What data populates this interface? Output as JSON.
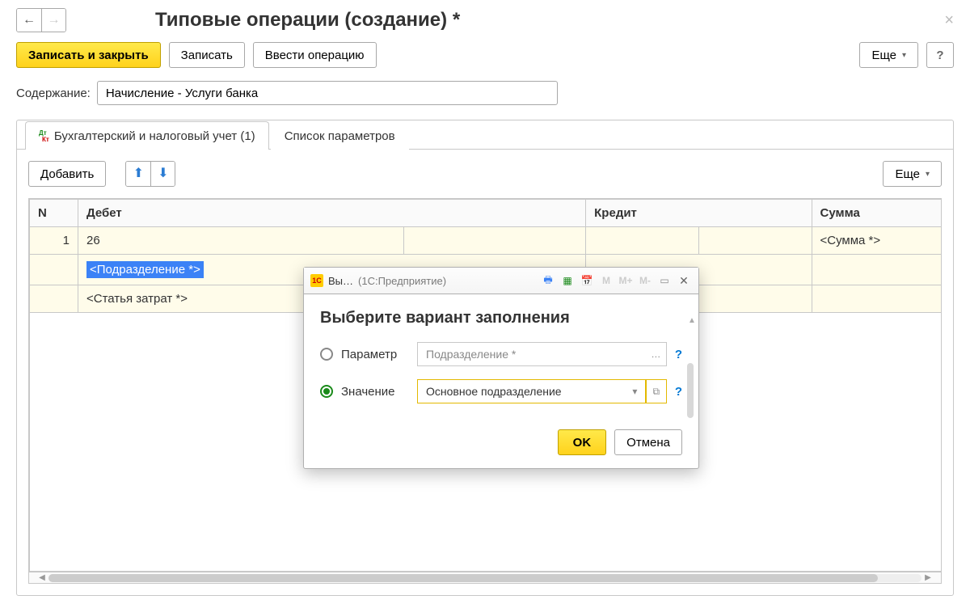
{
  "header": {
    "title": "Типовые операции (создание) *",
    "close_icon": "×"
  },
  "toolbar": {
    "save_close": "Записать и закрыть",
    "save": "Записать",
    "enter_op": "Ввести операцию",
    "more": "Еще",
    "help": "?"
  },
  "content_field": {
    "label": "Содержание:",
    "value": "Начисление - Услуги банка"
  },
  "tabs": {
    "tab1": "Бухгалтерский и налоговый учет (1)",
    "tab2": "Список параметров"
  },
  "inner_toolbar": {
    "add": "Добавить",
    "up": "⬆",
    "down": "⬇",
    "more": "Еще"
  },
  "table": {
    "headers": {
      "n": "N",
      "debit": "Дебет",
      "credit": "Кредит",
      "sum": "Сумма"
    },
    "row": {
      "n": "1",
      "debit_account": "26",
      "subdivision": "<Подразделение *>",
      "cost_item": "<Статья затрат *>",
      "sum": "<Сумма *>"
    }
  },
  "dialog": {
    "app_icon": "1C",
    "title_short": "Вы…",
    "title_app": "(1С:Предприятие)",
    "heading": "Выберите вариант заполнения",
    "option1": {
      "label": "Параметр",
      "value": "Подразделение *"
    },
    "option2": {
      "label": "Значение",
      "value": "Основное подразделение"
    },
    "dots": "…",
    "dropdown": "▾",
    "expand": "⧉",
    "help": "?",
    "m": "M",
    "mplus": "M+",
    "mminus": "M-",
    "win_min": "▭",
    "win_close": "✕",
    "ok": "OK",
    "cancel": "Отмена"
  }
}
